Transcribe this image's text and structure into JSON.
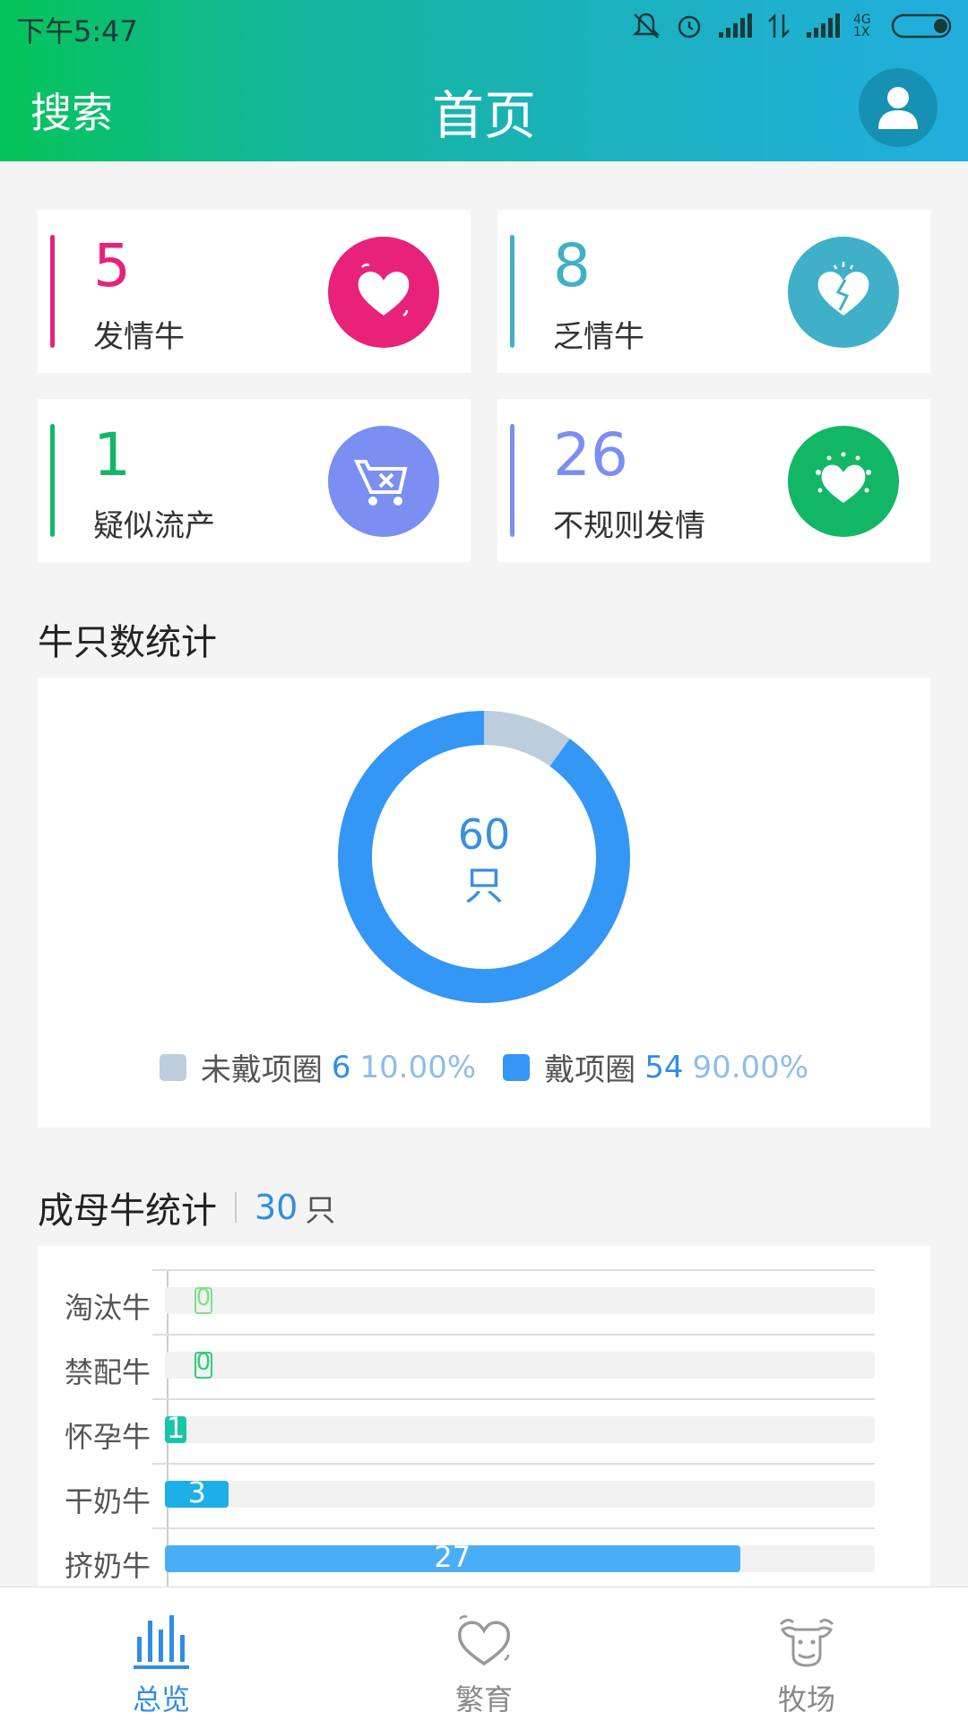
{
  "status_bar": {
    "time": "下午5:47",
    "network": "4G 1X"
  },
  "header": {
    "search_label": "搜索",
    "title": "首页"
  },
  "stat_cards": [
    {
      "value": "5",
      "label": "发情牛",
      "color": "#e8217a",
      "icon": "heart-icon"
    },
    {
      "value": "8",
      "label": "乏情牛",
      "color": "#3fb0c8",
      "icon": "broken-heart-icon"
    },
    {
      "value": "1",
      "label": "疑似流产",
      "color": "#12b765",
      "icon": "stroller-icon"
    },
    {
      "value": "26",
      "label": "不规则发情",
      "color": "#7a8ff1",
      "icon": "sparkle-heart-icon"
    }
  ],
  "cattle_stats": {
    "title": "牛只数统计",
    "center_value": "60",
    "center_unit": "只",
    "legend": [
      {
        "name": "未戴项圈",
        "count": "6",
        "percent": "10.00%",
        "color": "#bccedb"
      },
      {
        "name": "戴项圈",
        "count": "54",
        "percent": "90.00%",
        "color": "#3496f5"
      }
    ]
  },
  "cow_stats": {
    "title": "成母牛统计",
    "total": "30",
    "unit": "只"
  },
  "chart_data": [
    {
      "type": "pie",
      "labels": [
        "未戴项圈",
        "戴项圈"
      ],
      "values": [
        6,
        54
      ],
      "colors": [
        "#bccedb",
        "#3496f5"
      ]
    },
    {
      "type": "bar",
      "categories": [
        "淘汰牛",
        "禁配牛",
        "怀孕牛",
        "干奶牛",
        "挤奶牛"
      ],
      "values": [
        0,
        0,
        1,
        3,
        27
      ],
      "value_labels": [
        "0",
        "0",
        "1",
        "3",
        "27"
      ],
      "colors": [
        "#7fe08a",
        "#2fcf7a",
        "#17c6a8",
        "#1db0e6",
        "#4aaef6"
      ],
      "xlim": [
        0,
        30
      ]
    }
  ],
  "bottom_nav": [
    {
      "label": "总览",
      "icon": "chart-bars-icon",
      "active": true
    },
    {
      "label": "繁育",
      "icon": "heart-outline-icon",
      "active": false
    },
    {
      "label": "牧场",
      "icon": "cow-icon",
      "active": false
    }
  ],
  "colors": {
    "accent": "#2f8de4",
    "header_start": "#05c45a",
    "header_end": "#22aede"
  }
}
